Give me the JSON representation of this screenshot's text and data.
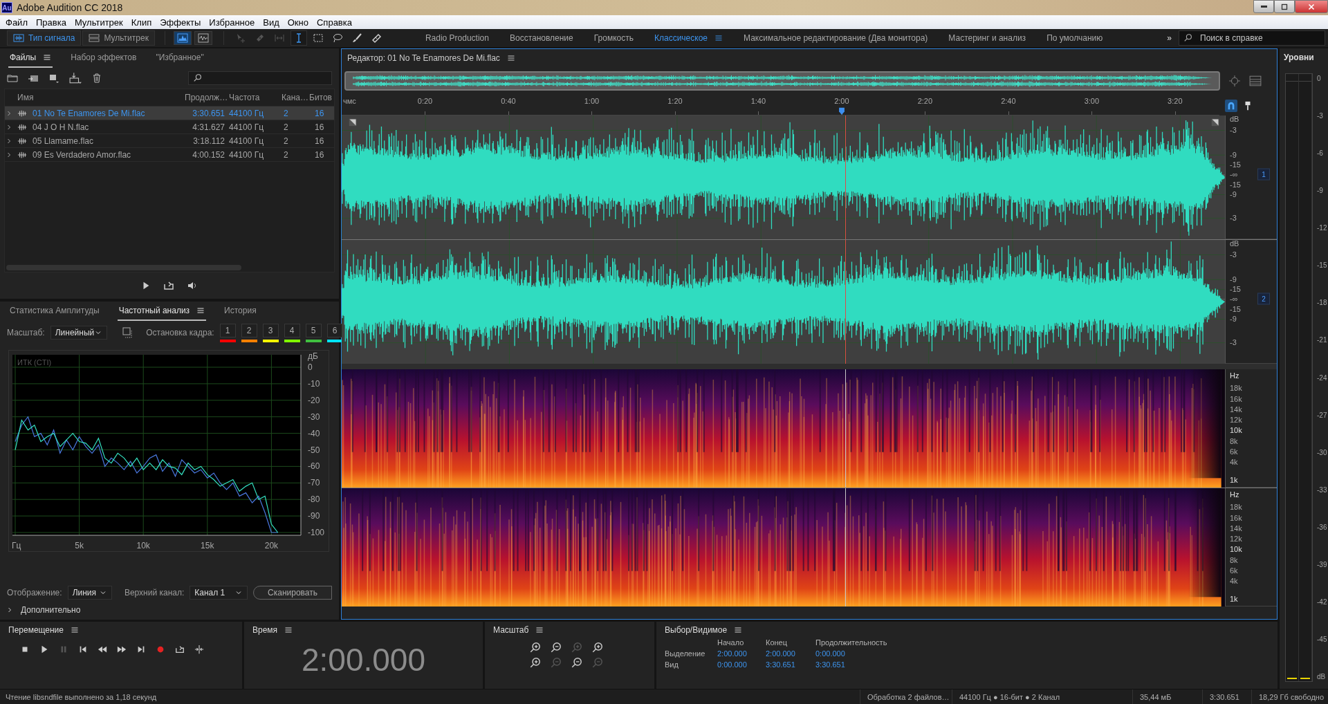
{
  "window": {
    "app_icon": "Au",
    "title": "Adobe Audition CC 2018"
  },
  "menu": [
    "Файл",
    "Правка",
    "Мультитрек",
    "Клип",
    "Эффекты",
    "Избранное",
    "Вид",
    "Окно",
    "Справка"
  ],
  "toolbar": {
    "modes": [
      {
        "kind": "waveform",
        "label": "Тип сигнала",
        "selected": true
      },
      {
        "kind": "multitrack",
        "label": "Мультитрек",
        "selected": false
      }
    ],
    "views": [
      {
        "kind": "waveform-view",
        "selected": true
      },
      {
        "kind": "spectrum-view",
        "selected": false
      }
    ],
    "tools": [
      {
        "kind": "move",
        "selected": false,
        "disabled": true
      },
      {
        "kind": "razor",
        "selected": false,
        "disabled": true
      },
      {
        "kind": "slip",
        "selected": false,
        "disabled": true
      },
      {
        "kind": "time-selection",
        "selected": true,
        "disabled": false
      },
      {
        "kind": "marquee",
        "selected": false,
        "disabled": false
      },
      {
        "kind": "lasso",
        "selected": false,
        "disabled": false
      },
      {
        "kind": "brush",
        "selected": false,
        "disabled": false
      },
      {
        "kind": "spot-healing",
        "selected": false,
        "disabled": false
      }
    ],
    "workspaces": [
      {
        "label": "Radio Production",
        "selected": false
      },
      {
        "label": "Восстановление",
        "selected": false
      },
      {
        "label": "Громкость",
        "selected": false
      },
      {
        "label": "Классическое",
        "selected": true
      },
      {
        "label": "Максимальное редактирование (Два монитора)",
        "selected": false
      },
      {
        "label": "Мастеринг и анализ",
        "selected": false
      },
      {
        "label": "По умолчанию",
        "selected": false
      }
    ],
    "more": "»",
    "search": {
      "placeholder": "Поиск в справке"
    }
  },
  "files": {
    "tabs": [
      {
        "label": "Файлы",
        "selected": true
      },
      {
        "label": "Набор эффектов",
        "selected": false
      },
      {
        "label": "\"Избранное\"",
        "selected": false
      }
    ],
    "columns": [
      "Имя",
      "Продолж…",
      "Частота",
      "Кана…",
      "Битов"
    ],
    "rows": [
      {
        "name": "01 No Te Enamores De Mi.flac",
        "duration": "3:30.651",
        "rate": "44100 Гц",
        "channels": "2",
        "bits": "16",
        "selected": true
      },
      {
        "name": "04 J O H N.flac",
        "duration": "4:31.627",
        "rate": "44100 Гц",
        "channels": "2",
        "bits": "16",
        "selected": false
      },
      {
        "name": "05 Llamame.flac",
        "duration": "3:18.112",
        "rate": "44100 Гц",
        "channels": "2",
        "bits": "16",
        "selected": false
      },
      {
        "name": "09 Es Verdadero Amor.flac",
        "duration": "4:00.152",
        "rate": "44100 Гц",
        "channels": "2",
        "bits": "16",
        "selected": false
      }
    ]
  },
  "analysis": {
    "tabs": [
      {
        "label": "Статистика Амплитуды",
        "selected": false
      },
      {
        "label": "Частотный анализ",
        "selected": true
      },
      {
        "label": "История",
        "selected": false
      }
    ],
    "scale_label": "Масштаб:",
    "scale": "Линейный",
    "freeze_label": "Остановка кадра:",
    "freeze_buttons": [
      {
        "label": "1",
        "color": "#ff0000"
      },
      {
        "label": "2",
        "color": "#ff8000"
      },
      {
        "label": "3",
        "color": "#ffff00"
      },
      {
        "label": "4",
        "color": "#80ff00"
      },
      {
        "label": "5",
        "color": "#40c040"
      },
      {
        "label": "6",
        "color": "#00e5ff"
      }
    ],
    "legend": "ИТК (CTI)",
    "chart_data": {
      "type": "line",
      "ylabel": "дБ",
      "xlim": [
        0,
        22300
      ],
      "ylim": [
        -100,
        0
      ],
      "grid": true,
      "xticks": [
        {
          "value": 0,
          "label": "Гц"
        },
        {
          "value": 5000,
          "label": "5k"
        },
        {
          "value": 10000,
          "label": "10k"
        },
        {
          "value": 15000,
          "label": "15k"
        },
        {
          "value": 20000,
          "label": "20k"
        }
      ],
      "yticks": [
        0,
        -10,
        -20,
        -30,
        -40,
        -50,
        -60,
        -70,
        -80,
        -90,
        -100
      ],
      "x": [
        0,
        500,
        1000,
        1500,
        2000,
        2500,
        3000,
        3500,
        4000,
        4500,
        5000,
        5500,
        6000,
        6500,
        7000,
        7500,
        8000,
        8500,
        9000,
        9500,
        10000,
        10500,
        11000,
        11500,
        12000,
        12500,
        13000,
        13500,
        14000,
        14500,
        15000,
        15500,
        16000,
        16500,
        17000,
        17500,
        18000,
        18500,
        19000,
        19500,
        20000,
        20500
      ],
      "series": [
        {
          "color": "#4a78e0",
          "values": [
            -45,
            -35,
            -30,
            -42,
            -40,
            -47,
            -38,
            -52,
            -44,
            -50,
            -42,
            -48,
            -52,
            -47,
            -60,
            -55,
            -58,
            -62,
            -57,
            -64,
            -60,
            -55,
            -53,
            -63,
            -58,
            -66,
            -56,
            -60,
            -64,
            -62,
            -67,
            -64,
            -70,
            -74,
            -70,
            -78,
            -76,
            -82,
            -78,
            -88,
            -100,
            -100
          ]
        },
        {
          "color": "#34e0c0",
          "values": [
            -50,
            -32,
            -38,
            -35,
            -45,
            -42,
            -40,
            -48,
            -44,
            -40,
            -45,
            -46,
            -50,
            -43,
            -55,
            -58,
            -52,
            -55,
            -60,
            -55,
            -62,
            -58,
            -62,
            -56,
            -60,
            -61,
            -65,
            -58,
            -62,
            -60,
            -65,
            -68,
            -72,
            -70,
            -68,
            -75,
            -72,
            -70,
            -80,
            -78,
            -95,
            -100
          ]
        }
      ]
    },
    "display_label": "Отображение:",
    "display": "Линия",
    "channel_label": "Верхний канал:",
    "channel": "Канал 1",
    "scan_button": "Сканировать",
    "advanced": "Дополнительно"
  },
  "editor": {
    "title": "Редактор: 01 No Te Enamores De Mi.flac",
    "ruler_unit": "чмс",
    "ruler": [
      "0:20",
      "0:40",
      "1:00",
      "1:20",
      "1:40",
      "2:00",
      "2:20",
      "2:40",
      "3:00",
      "3:20"
    ],
    "playhead": {
      "level": 0.5697
    },
    "channels": [
      {
        "label": "1",
        "scale": [
          "dB",
          "-3",
          "-9",
          "-15",
          "-∞",
          "-15",
          "-9",
          "-3"
        ]
      },
      {
        "label": "2",
        "scale": [
          "dB",
          "-3",
          "-9",
          "-15",
          "-∞",
          "-15",
          "-9",
          "-3"
        ]
      }
    ],
    "spectral_channels": [
      {
        "scale": [
          "Hz",
          "18k",
          "16k",
          "14k",
          "12k",
          "10k",
          "8k",
          "6k",
          "4k",
          "1k"
        ]
      },
      {
        "scale": [
          "Hz",
          "18k",
          "16k",
          "14k",
          "12k",
          "10k",
          "8k",
          "6k",
          "4k",
          "1k"
        ]
      }
    ]
  },
  "levels": {
    "title": "Уровни",
    "ticks": [
      "0",
      "-3",
      "-6",
      "-9",
      "-12",
      "-15",
      "-18",
      "-21",
      "-24",
      "-27",
      "-30",
      "-33",
      "-36",
      "-39",
      "-42",
      "-45",
      "dB"
    ]
  },
  "transport": {
    "title": "Перемещение"
  },
  "time": {
    "title": "Время",
    "value": "2:00.000"
  },
  "zoom": {
    "title": "Масштаб"
  },
  "selection": {
    "title": "Выбор/Видимое",
    "headers": [
      "Начало",
      "Конец",
      "Продолжительность"
    ],
    "rows": [
      {
        "label": "Выделение",
        "values": [
          "2:00.000",
          "2:00.000",
          "0:00.000"
        ]
      },
      {
        "label": "Вид",
        "values": [
          "0:00.000",
          "3:30.651",
          "3:30.651"
        ]
      }
    ]
  },
  "status": {
    "message": "Чтение libsndfile выполнено за 1,18 секунд",
    "processing": "Обработка 2 файлов…",
    "format": "44100 Гц ● 16-бит ● 2 Канал",
    "size": "35,44 мБ",
    "duration": "3:30.651",
    "free": "18,29 Гб свободно"
  }
}
